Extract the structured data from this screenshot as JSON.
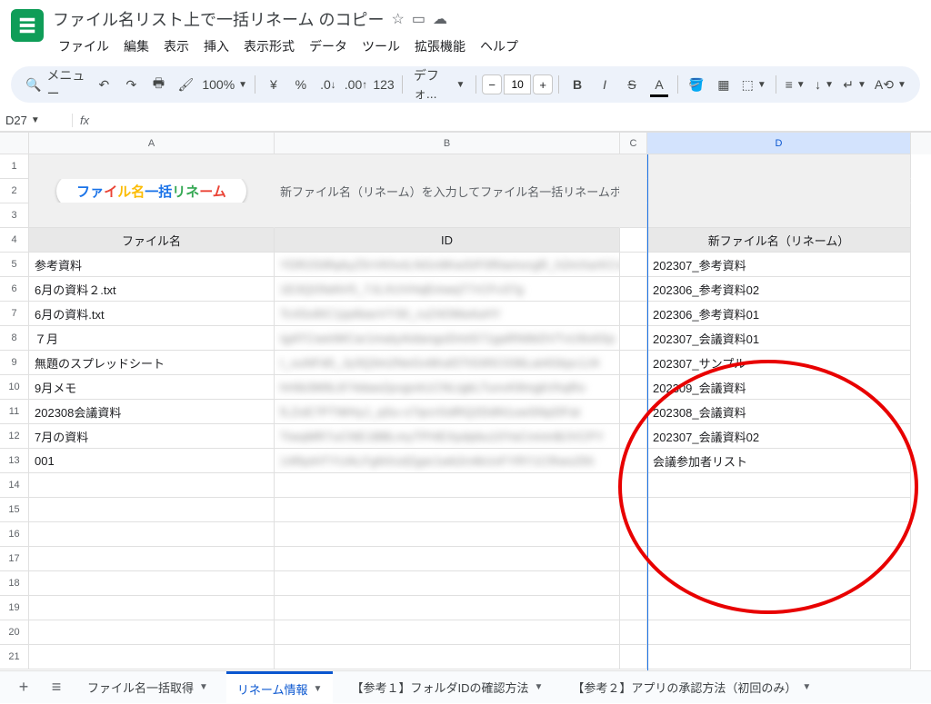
{
  "doc": {
    "title": "ファイル名リスト上で一括リネーム のコピー"
  },
  "menu": {
    "file": "ファイル",
    "edit": "編集",
    "view": "表示",
    "insert": "挿入",
    "format": "表示形式",
    "data": "データ",
    "tools": "ツール",
    "extensions": "拡張機能",
    "help": "ヘルプ"
  },
  "toolbar": {
    "search_label": "メニュー",
    "zoom": "100%",
    "font": "デフォ...",
    "font_size": "10"
  },
  "namebox": "D27",
  "columns": [
    "A",
    "B",
    "C",
    "D"
  ],
  "banner_instruction": "新ファイル名（リネーム）を入力してファイル名一括リネームボタンを押してください。",
  "headers": {
    "A": "ファイル名",
    "B": "ID",
    "D": "新ファイル名（リネーム）"
  },
  "rows": [
    {
      "A": "参考資料",
      "B": "YDR2S9fqAyZ5rVKhvtLNGn9KwSIF0RtamorgR_h2mXarKCvDU",
      "D": "202307_参考資料"
    },
    {
      "A": "6月の資料２.txt",
      "B": "1E3QOfaNV5_7JLXUVHqEmwqT7rCFv37g",
      "D": "202306_参考資料02"
    },
    {
      "A": "6月の資料.txt",
      "B": "Tc4Sx8IC1jq4bavVY30_ruZ4OMa4uHY",
      "D": "202306_参考資料01"
    },
    {
      "A": "７月",
      "B": "IgATCwetWCar1matyAidangoDmtS71gaRN6kDVTvU9o6Sp",
      "D": "202307_会議資料01"
    },
    {
      "A": "無題のスプレッドシート",
      "B": "I_xuNFd0_Jy3Q3m2NeGv6Kaf2TiG95C036Lat4Gkpc1J4",
      "D": "202307_サンプル"
    },
    {
      "A": "9月メモ",
      "B": "hHtb3M9L874daw2pvgnA1CNLtgkLTunvK8mgkVhqRo",
      "D": "202309_会議資料"
    },
    {
      "A": "202308会議資料",
      "B": "fLZoE7PTWHyJ_qSu-s7ipcrGdRQ2DdN1uwSNpDFat",
      "D": "202308_会議資料"
    },
    {
      "A": "7月の資料",
      "B": "TiwqMR7uCNE1BBLmyTPHEXpdpbu10YaCnmmBJVCPY",
      "D": "202307_会議資料02"
    },
    {
      "A": "001",
      "B": "14RpiHTYUALFgNXzdZgar1wb2n4kUvFYRY1CRws25h",
      "D": "会議参加者リスト"
    }
  ],
  "sheets": {
    "s1": "ファイル名一括取得",
    "s2": "リネーム情報",
    "s3": "【参考１】フォルダIDの確認方法",
    "s4": "【参考２】アプリの承認方法（初回のみ）"
  },
  "chart_data": null
}
